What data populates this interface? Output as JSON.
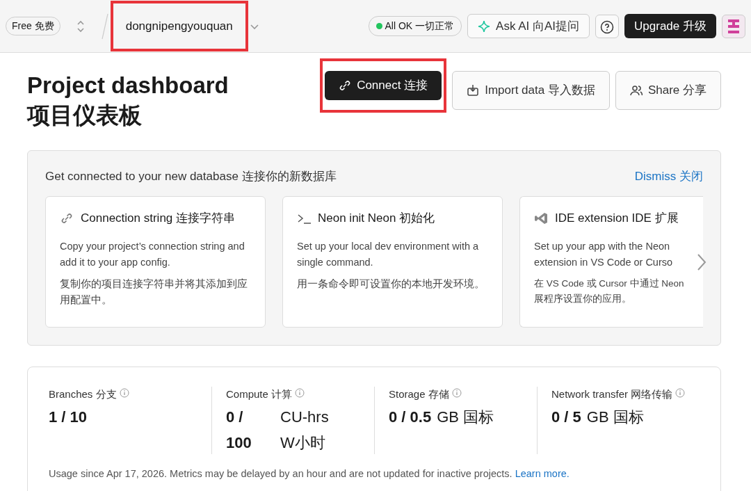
{
  "topbar": {
    "plan_badge": "Free 免费",
    "project": {
      "name": "dongnipengyouquan",
      "highlighted": true
    },
    "status": {
      "label": "All OK 一切正常",
      "color": "#22c55e"
    },
    "ask_ai": "Ask AI 向AI提问",
    "upgrade": "Upgrade 升级"
  },
  "header": {
    "title_lines": [
      "Project dashboard",
      "项目仪表板"
    ],
    "actions": [
      {
        "kind": "connect",
        "label": "Connect 连接",
        "primary": true,
        "highlighted": true
      },
      {
        "kind": "import",
        "label": "Import data 导入数据",
        "primary": false,
        "highlighted": false
      },
      {
        "kind": "share",
        "label": "Share 分享",
        "primary": false,
        "highlighted": false
      }
    ]
  },
  "getting_started": {
    "title": "Get connected to your new database 连接你的新数据库",
    "dismiss": "Dismiss 关闭",
    "cards": [
      {
        "kind": "link",
        "title": "Connection string 连接字符串",
        "lines": [
          "Copy your project’s connection string and add it to your app config."
        ],
        "cn_lines": [
          "复制你的项目连接字符串并将其添加到应用配置中。"
        ],
        "clipped": false
      },
      {
        "kind": "terminal",
        "title": "Neon init Neon 初始化",
        "lines": [
          "Set up your local dev environment with a single command."
        ],
        "cn_lines": [
          "用一条命令即可设置你的本地开发环境。"
        ],
        "clipped": false
      },
      {
        "kind": "ide",
        "title": "IDE extension IDE 扩展",
        "lines": [
          "Set up your app with the Neon",
          "extension in VS Code or Curso"
        ],
        "cn_lines": [
          "在 VS Code 或 Cursor 中通过 Neon",
          "展程序设置你的应用。"
        ],
        "clipped": true
      }
    ]
  },
  "usage": {
    "metrics": [
      {
        "label": "Branches 分支",
        "rows": [
          [
            "1 / 10"
          ]
        ]
      },
      {
        "label": "Compute 计算",
        "rows": [
          [
            "0 /",
            "CU-hrs"
          ],
          [
            "100",
            "W小时"
          ]
        ]
      },
      {
        "label": "Storage 存储",
        "rows": [
          [
            "0 / 0.5",
            "GB 国标"
          ]
        ]
      },
      {
        "label": "Network transfer 网络传输",
        "rows": [
          [
            "0 / 5",
            "GB 国标"
          ]
        ]
      }
    ],
    "note": "Usage since Apr 17, 2026. Metrics may be delayed by an hour and are not updated for inactive projects.",
    "learn_more": "Learn more."
  }
}
